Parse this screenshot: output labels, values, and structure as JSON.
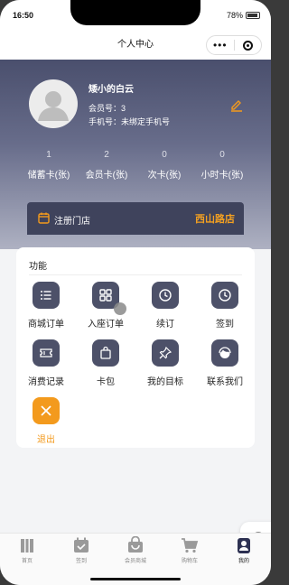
{
  "status_bar": {
    "time": "16:50",
    "battery": "78%",
    "battery_level": 0.78
  },
  "nav": {
    "title": "个人中心",
    "more_glyph": "•••"
  },
  "profile": {
    "name": "矮小的白云",
    "member_line": "会员号：3",
    "phone_line": "手机号：未绑定手机号"
  },
  "stats": [
    {
      "num": "1",
      "label": "储蓄卡(张)"
    },
    {
      "num": "2",
      "label": "会员卡(张)"
    },
    {
      "num": "0",
      "label": "次卡(张)"
    },
    {
      "num": "0",
      "label": "小时卡(张)"
    }
  ],
  "store": {
    "label": "注册门店",
    "value": "西山路店"
  },
  "functions": {
    "title": "功能",
    "items": [
      {
        "label": "商城订单",
        "icon": "list-icon"
      },
      {
        "label": "入座订单",
        "icon": "grid-icon"
      },
      {
        "label": "续订",
        "icon": "clock-icon"
      },
      {
        "label": "签到",
        "icon": "clock-icon"
      },
      {
        "label": "消费记录",
        "icon": "ticket-icon"
      },
      {
        "label": "卡包",
        "icon": "bag-icon"
      },
      {
        "label": "我的目标",
        "icon": "pin-icon"
      },
      {
        "label": "联系我们",
        "icon": "service-icon"
      },
      {
        "label": "退出",
        "icon": "close-icon"
      }
    ]
  },
  "tabs": [
    {
      "label": "首页",
      "icon": "home-icon"
    },
    {
      "label": "签到",
      "icon": "calendar-icon"
    },
    {
      "label": "会员商城",
      "icon": "shop-icon"
    },
    {
      "label": "购物车",
      "icon": "cart-icon"
    },
    {
      "label": "我的",
      "icon": "user-icon",
      "active": true
    }
  ],
  "colors": {
    "accent": "#f39a1d",
    "header_dark": "#4a4f6d",
    "icon_box": "#4d5169"
  }
}
